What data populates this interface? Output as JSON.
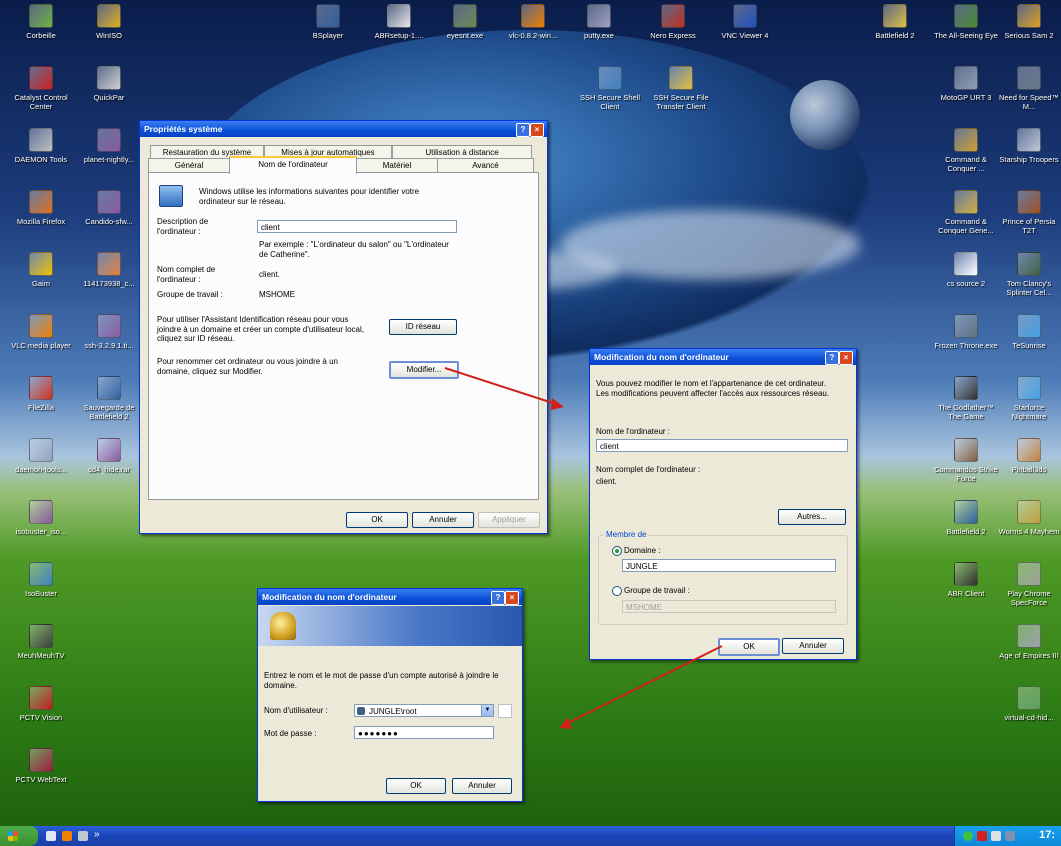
{
  "desktop_icons": [
    {
      "label": "Corbeille",
      "color": "#6db33f"
    },
    {
      "label": "WinISO",
      "color": "#e0b020"
    },
    {
      "label": "BSplayer",
      "color": "#3060a0"
    },
    {
      "label": "ABRsetup-1....",
      "color": "#e8e8e8"
    },
    {
      "label": "eyesnt.exe",
      "color": "#6a8a50"
    },
    {
      "label": "vlc-0.8.2-win...",
      "color": "#f08000"
    },
    {
      "label": "putty.exe",
      "color": "#a0a0c0"
    },
    {
      "label": "Nero Express",
      "color": "#c03020"
    },
    {
      "label": "VNC Viewer 4",
      "color": "#2050c0"
    },
    {
      "label": "Battlefield 2",
      "color": "#e0c040"
    },
    {
      "label": "The All-Seeing Eye",
      "color": "#4a8a30"
    },
    {
      "label": "Serious Sam 2",
      "color": "#e0a020"
    },
    {
      "label": "Catalyst Control Center",
      "color": "#d02020"
    },
    {
      "label": "QuickPar",
      "color": "#d0d0d0"
    },
    {
      "label": "SSH Secure Shell Client",
      "color": "#4080c0"
    },
    {
      "label": "SSH Secure File Transfer Client",
      "color": "#e0c040"
    },
    {
      "label": "MotoGP URT 3",
      "color": "#90a0b0"
    },
    {
      "label": "Need for Speed™ M...",
      "color": "#6a7a8a"
    },
    {
      "label": "DAEMON Tools",
      "color": "#c0c0c0"
    },
    {
      "label": "planet-nightly...",
      "color": "#8a5aa0"
    },
    {
      "label": "Command & Conquer ...",
      "color": "#d0a030"
    },
    {
      "label": "Starship Troopers",
      "color": "#c0c8d8"
    },
    {
      "label": "Mozilla Firefox",
      "color": "#e07020"
    },
    {
      "label": "Candido-sfw...",
      "color": "#8a5aa0"
    },
    {
      "label": "Command & Conquer Gene...",
      "color": "#d0b040"
    },
    {
      "label": "Prince of Persia T2T",
      "color": "#a05020"
    },
    {
      "label": "Gaim",
      "color": "#f0c000"
    },
    {
      "label": "114173938_c...",
      "color": "#e08040"
    },
    {
      "label": "cs source 2",
      "color": "#ffffff"
    },
    {
      "label": "Tom Clancy's Splinter Cel...",
      "color": "#406040"
    },
    {
      "label": "VLC media player",
      "color": "#f08000"
    },
    {
      "label": "ssh-3.2.9.1.ti...",
      "color": "#8a5aa0"
    },
    {
      "label": "Frozen Throne.exe",
      "color": "#607080"
    },
    {
      "label": "TeSunrise",
      "color": "#40a0e0"
    },
    {
      "label": "FileZilla",
      "color": "#d03020"
    },
    {
      "label": "Sauvegarde de Battlefield 2",
      "color": "#3060a0"
    },
    {
      "label": "The Godfather™ The Game",
      "color": "#303030"
    },
    {
      "label": "Starforce Nightmare",
      "color": "#40a0e0"
    },
    {
      "label": "daemon-tools...",
      "color": "#90a0c0"
    },
    {
      "label": "sd4_hide.rar",
      "color": "#8a5aa0"
    },
    {
      "label": "Commandos Strike Force",
      "color": "#806040"
    },
    {
      "label": "Pinball3ds",
      "color": "#c08040"
    },
    {
      "label": "isobuster_iso...",
      "color": "#8a5aa0"
    },
    {
      "label": "Battlefield 2",
      "color": "#3060a0"
    },
    {
      "label": "Worms 4 Mayhem",
      "color": "#c0a040"
    },
    {
      "label": "ABR Client",
      "color": "#303030"
    },
    {
      "label": "Play Chrome SpecForce",
      "color": "#a0a0a0"
    },
    {
      "label": "IsoBuster",
      "color": "#4080c0"
    },
    {
      "label": "Age of Empires III",
      "color": "#a0a0b0"
    },
    {
      "label": "MeuhMeuhTV",
      "color": "#404040"
    },
    {
      "label": "virtual-cd-hid...",
      "color": "#60a060"
    },
    {
      "label": "PCTV Vision",
      "color": "#c02020"
    },
    {
      "label": "PCTV WebText",
      "color": "#a02040"
    }
  ],
  "sysprops": {
    "title": "Propriétés système",
    "tabs_row1": [
      "Restauration du système",
      "Mises à jour automatiques",
      "Utilisation à distance"
    ],
    "tabs_row2": [
      "Général",
      "Nom de l'ordinateur",
      "Matériel",
      "Avancé"
    ],
    "intro": "Windows utilise les informations suivantes pour identifier votre ordinateur sur le réseau.",
    "desc_label": "Description de l'ordinateur :",
    "desc_value": "client",
    "example": "Par exemple : \"L'ordinateur du salon\" ou \"L'ordinateur de Catherine\".",
    "fullname_label": "Nom complet de l'ordinateur :",
    "fullname_value": "client.",
    "workgroup_label": "Groupe de travail :",
    "workgroup_value": "MSHOME",
    "netid_text": "Pour utiliser l'Assistant Identification réseau pour vous joindre à un domaine et créer un compte d'utilisateur local, cliquez sur ID réseau.",
    "netid_button": "ID réseau",
    "rename_text": "Pour renommer cet ordinateur ou vous joindre à un domaine, cliquez sur Modifier.",
    "modify_button": "Modifier...",
    "ok": "OK",
    "cancel": "Annuler",
    "apply": "Appliquer"
  },
  "rename_dialog": {
    "title": "Modification du nom d'ordinateur",
    "intro": "Vous pouvez modifier le nom et l'appartenance de cet ordinateur. Les modifications peuvent affecter l'accès aux ressources réseau.",
    "name_label": "Nom de l'ordinateur :",
    "name_value": "client",
    "fullname_label": "Nom complet de l'ordinateur :",
    "fullname_value": "client.",
    "others_button": "Autres...",
    "member_of": "Membre de",
    "domain_label": "Domaine :",
    "domain_value": "JUNGLE",
    "workgroup_label": "Groupe de travail :",
    "workgroup_value": "MSHOME",
    "ok": "OK",
    "cancel": "Annuler"
  },
  "cred_dialog": {
    "title": "Modification du nom d'ordinateur",
    "intro": "Entrez le nom et le mot de passe d'un compte autorisé à joindre le domaine.",
    "user_label": "Nom d'utilisateur :",
    "user_value": "JUNGLE\\root",
    "password_label": "Mot de passe :",
    "password_value": "●●●●●●●",
    "ok": "OK",
    "cancel": "Annuler"
  },
  "taskbar": {
    "quicklaunch_more": "»",
    "clock": "17:"
  }
}
